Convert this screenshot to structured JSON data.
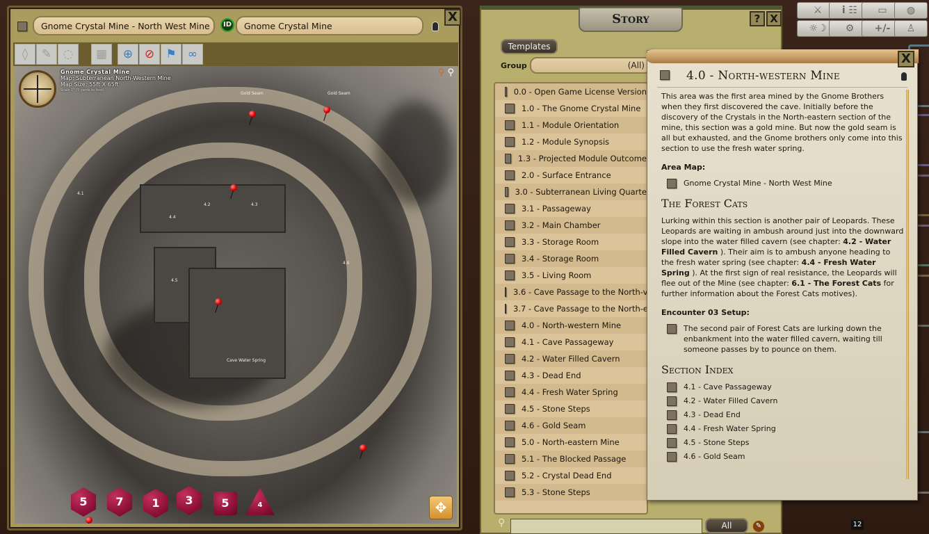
{
  "map_window": {
    "image_name": "Gnome Crystal Mine - North West Mine",
    "id_badge": "ID",
    "module_name": "Gnome Crystal Mine",
    "close_label": "X",
    "toolbar": [
      {
        "name": "mask-tool",
        "glyph": "◊",
        "enabled": false
      },
      {
        "name": "draw-tool",
        "glyph": "✎",
        "enabled": false
      },
      {
        "name": "erase-tool",
        "glyph": "◌",
        "enabled": false
      },
      {
        "name": "grid-tool",
        "glyph": "▦",
        "enabled": false
      },
      {
        "name": "target-tool",
        "glyph": "⊕",
        "enabled": true
      },
      {
        "name": "no-targeting-tool",
        "glyph": "⊘",
        "enabled": true
      },
      {
        "name": "flag-tool",
        "glyph": "⚑",
        "enabled": true
      },
      {
        "name": "link-tool",
        "glyph": "∞",
        "enabled": true
      }
    ],
    "map_title": {
      "name": "Gnome Crystal Mine",
      "map": "Map: Subterranean North-Western Mine",
      "size": "Map Size: 55ft X 65ft",
      "scale": "Scale 1\" (5 yards to foot)"
    },
    "map_labels": [
      "Gold Seam",
      "Gold Seam",
      "4.1",
      "4.2",
      "4.3",
      "4.4",
      "4.5",
      "4.6",
      "Cave Water Spring"
    ],
    "dice": [
      {
        "name": "d20",
        "face": "5"
      },
      {
        "name": "d12",
        "face": "7"
      },
      {
        "name": "d10",
        "face": "1"
      },
      {
        "name": "d8",
        "face": "3"
      },
      {
        "name": "d6",
        "face": "5"
      },
      {
        "name": "d4",
        "face": "4"
      }
    ]
  },
  "story_window": {
    "title": "Story",
    "help_label": "?",
    "close_label": "X",
    "templates_label": "Templates",
    "group_label": "Group",
    "group_value": "(All)",
    "items": [
      "0.0 - Open Game License Version",
      "1.0 - The Gnome Crystal Mine",
      "1.1 - Module Orientation",
      "1.2 - Module Synopsis",
      "1.3 - Projected Module Outcome",
      "2.0 - Surface Entrance",
      "3.0 - Subterranean Living Quarte",
      "3.1 - Passageway",
      "3.2 - Main Chamber",
      "3.3 - Storage Room",
      "3.4 - Storage Room",
      "3.5 - Living Room",
      "3.6 - Cave Passage to the North-v",
      "3.7 - Cave Passage to the North-e",
      "4.0 - North-western Mine",
      "4.1 - Cave Passageway",
      "4.2 - Water Filled Cavern",
      "4.3 - Dead End",
      "4.4 - Fresh Water Spring",
      "4.5 - Stone Steps",
      "4.6 - Gold Seam",
      "5.0 - North-eastern Mine",
      "5.1 - The Blocked Passage",
      "5.2 - Crystal Dead End",
      "5.3 - Stone Steps"
    ],
    "search_value": "",
    "filter_label": "All"
  },
  "top_toolbar": [
    {
      "name": "combat-tracker",
      "glyph": "⚔"
    },
    {
      "name": "party-sheet",
      "glyph": "i ☷"
    },
    {
      "name": "library",
      "glyph": "▭"
    },
    {
      "name": "tokens",
      "glyph": "◍"
    },
    {
      "name": "calendar",
      "glyph": "☼☽"
    },
    {
      "name": "options",
      "glyph": "⚙"
    },
    {
      "name": "modifiers",
      "glyph": "+/-"
    },
    {
      "name": "character-select",
      "glyph": "♙"
    }
  ],
  "note_window": {
    "title": "4.0 - North-western Mine",
    "close_label": "X",
    "intro": "This area was the first area mined by the Gnome Brothers when they first discovered the cave. Initially before the discovery of the Crystals in the North-eastern section of the mine, this section was a gold mine. But now the gold seam is all but exhausted, and the Gnome brothers only come into this section to use the fresh water spring.",
    "area_map_heading": "Area Map:",
    "area_map_link": "Gnome Crystal Mine - North West Mine",
    "section1_heading": "The Forest Cats",
    "section1_p": {
      "a": "Lurking within this section is another pair of Leopards. These Leopards are waiting in ambush around just into the downward slope into the water filled cavern (see chapter: ",
      "b": "4.2 - Water Filled Cavern",
      "c": " ). Their aim is to ambush anyone heading to the fresh water spring (see chapter: ",
      "d": "4.4 - Fresh Water Spring",
      "e": " ). At the first sign of real resistance, the Leopards will flee out of the Mine (see chapter: ",
      "f": "6.1 - The Forest Cats",
      "g": " for further information about the Forest Cats motives)."
    },
    "encounter_heading": "Encounter 03 Setup:",
    "encounter_link": "The second pair of Forest Cats are lurking down the enbankment into the water filled cavern, waiting till someone passes by to pounce on them.",
    "index_heading": "Section Index",
    "index_links": [
      "4.1 - Cave Passageway",
      "4.2 - Water Filled Cavern",
      "4.3 - Dead End",
      "4.4 - Fresh Water Spring",
      "4.5 - Stone Steps",
      "4.6 - Gold Seam"
    ]
  },
  "status": {
    "counter": "12"
  }
}
